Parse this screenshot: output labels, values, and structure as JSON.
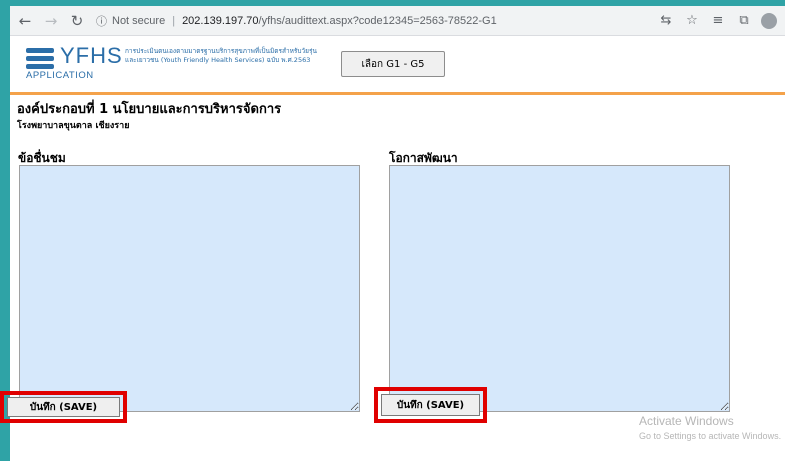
{
  "browser": {
    "security_label": "Not secure",
    "host": "202.139.197.70",
    "path": "/yfhs/audittext.aspx?code12345=2563-78522-G1",
    "icons": [
      "back-icon",
      "forward-icon",
      "reload-icon",
      "info-icon",
      "translate-icon",
      "star-icon",
      "reading-list-icon",
      "collections-icon",
      "profile-icon"
    ]
  },
  "header": {
    "logo_text": "YFHS",
    "logo_sub": "APPLICATION",
    "tagline_line1": "การประเมินตนเองตามมาตรฐานบริการสุขภาพที่เป็นมิตรสำหรับวัยรุ่น",
    "tagline_line2": "และเยาวชน  (Youth Friendly Health Services)  ฉบับ พ.ศ.2563",
    "select_button": "เลือก G1 - G5"
  },
  "content": {
    "section_title": "องค์ประกอบที่ 1 นโยบายและการบริหารจัดการ",
    "hospital_name": "โรงพยาบาลขุนตาล เชียงราย",
    "strengths_label": "ข้อชื่นชม",
    "opportunities_label": "โอกาสพัฒนา",
    "strengths_value": "",
    "opportunities_value": ""
  },
  "actions": {
    "save_left": "บันทึก (SAVE)",
    "save_right": "บันทึก (SAVE)"
  },
  "watermark": {
    "title": "Activate Windows",
    "subtitle": "Go to Settings to activate Windows."
  },
  "colors": {
    "accent": "#2b6ea8",
    "divider": "#f4a24a",
    "textarea_bg": "#d6e8fb",
    "highlight": "#e00000"
  }
}
